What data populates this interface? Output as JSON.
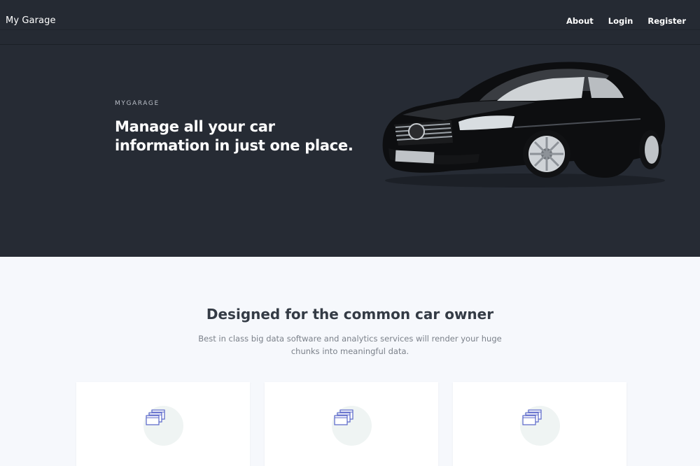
{
  "navbar": {
    "brand": "My Garage",
    "links": [
      {
        "label": "About"
      },
      {
        "label": "Login"
      },
      {
        "label": "Register"
      }
    ]
  },
  "hero": {
    "eyebrow": "MYGARAGE",
    "headline": "Manage all your car information in just one place.",
    "image_icon": "black-sedan-car-image"
  },
  "features": {
    "title": "Designed for the common car owner",
    "subtitle": "Best in class big data software and analytics services will render your huge chunks into meaningful data.",
    "cards": [
      {
        "icon": "stacked-windows-icon"
      },
      {
        "icon": "stacked-windows-icon"
      },
      {
        "icon": "stacked-windows-icon"
      }
    ]
  },
  "colors": {
    "nav_bg": "#252a33",
    "hero_bg": "#262b34",
    "page_bg": "#f6f8fc",
    "icon_accent": "#5865c9",
    "icon_circle": "#eff4f3"
  }
}
